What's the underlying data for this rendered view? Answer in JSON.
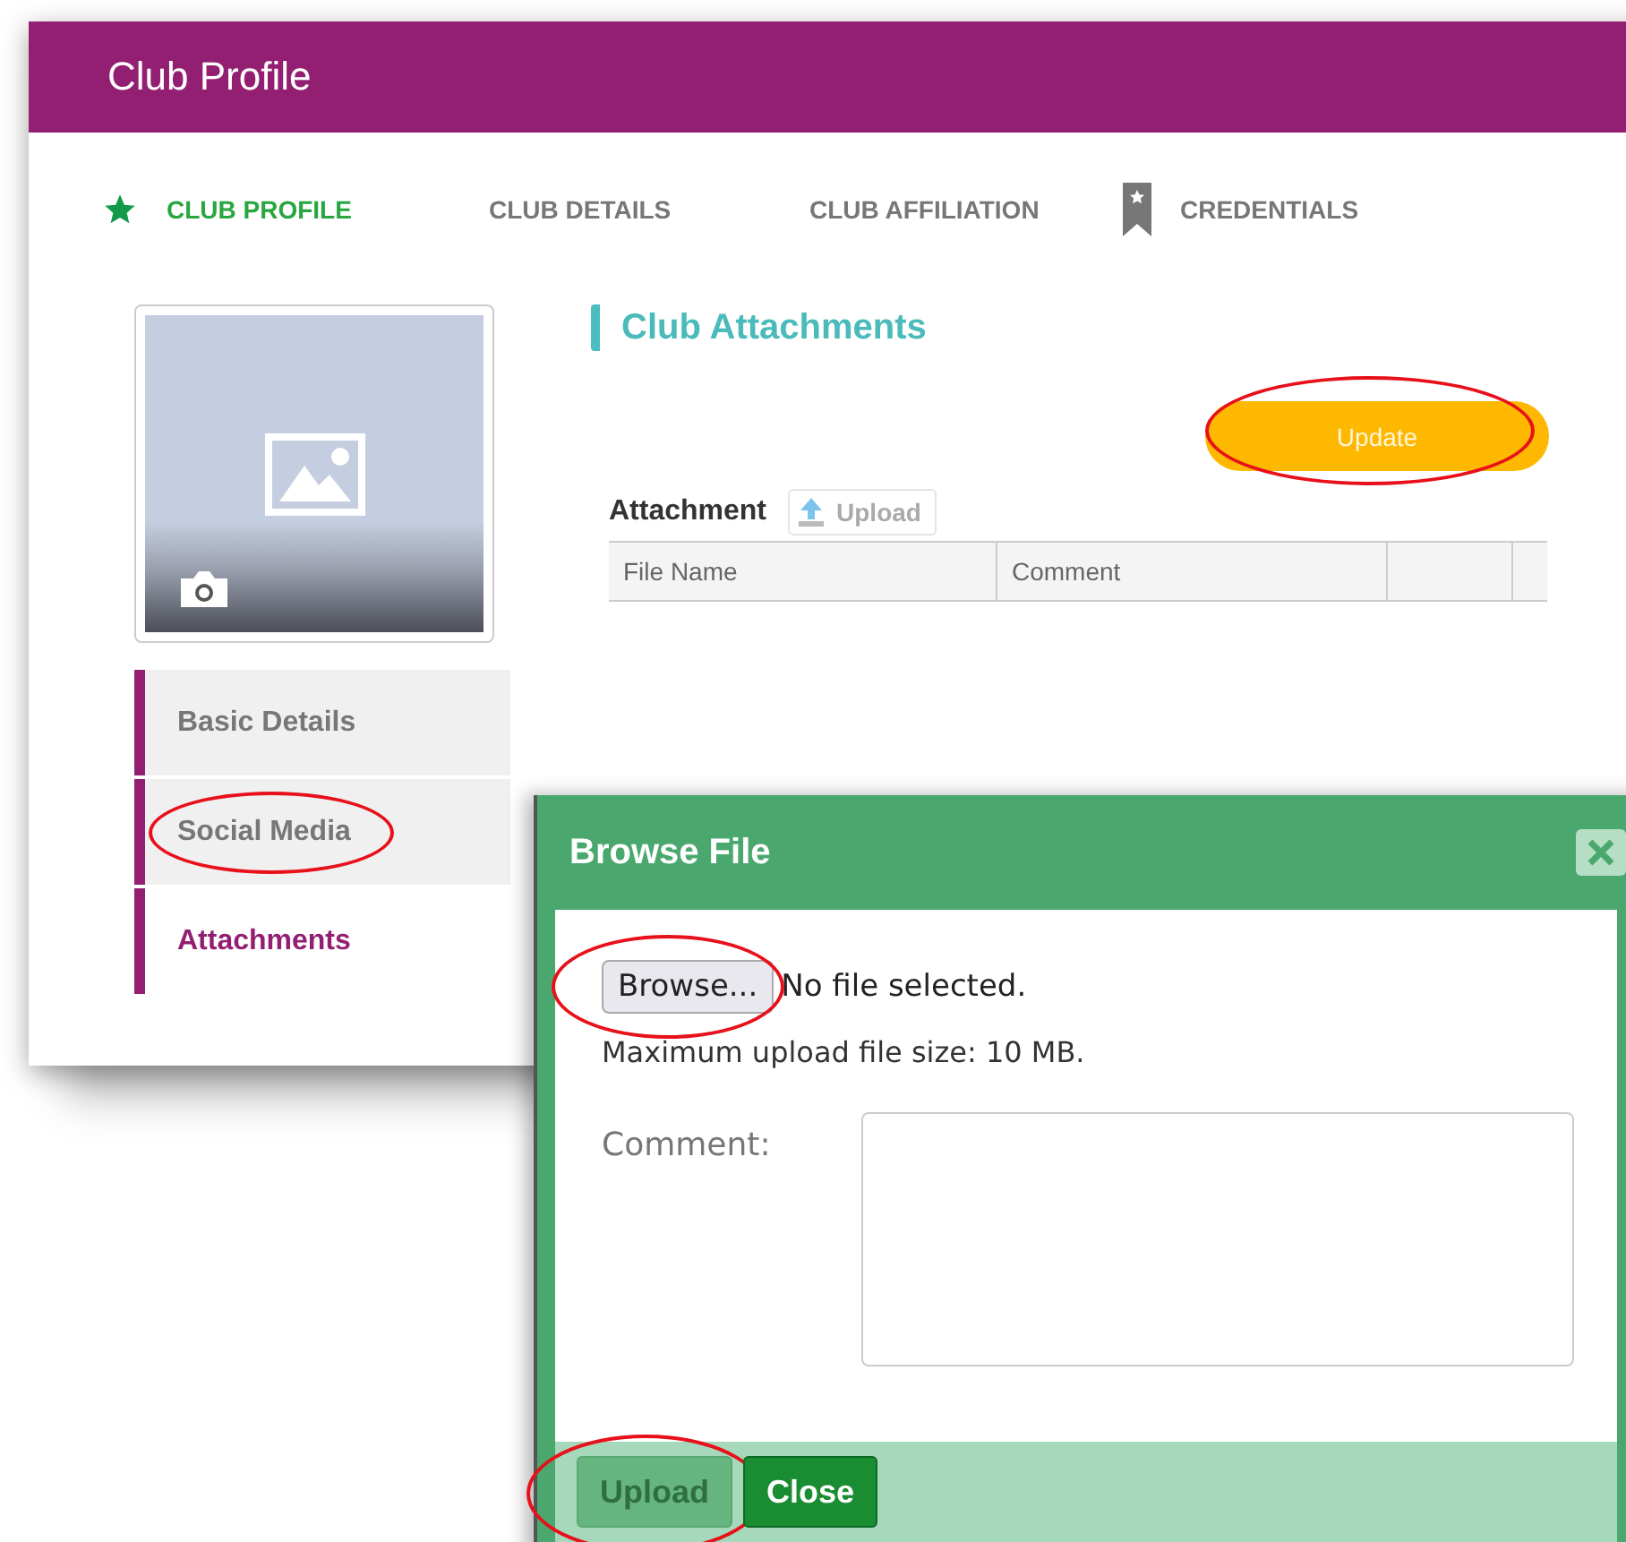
{
  "window": {
    "title": "Club Profile"
  },
  "tabs": [
    {
      "label": "CLUB PROFILE",
      "kind": "starred",
      "selected": true
    },
    {
      "label": "CLUB DETAILS",
      "kind": "plain",
      "selected": false
    },
    {
      "label": "CLUB AFFILIATION",
      "kind": "plain",
      "selected": false
    },
    {
      "label": "CREDENTIALS",
      "kind": "bookmarked",
      "selected": false
    }
  ],
  "sidebar": {
    "items": [
      {
        "label": "Basic Details",
        "selected": false,
        "circled": false
      },
      {
        "label": "Social Media",
        "selected": false,
        "circled": true
      },
      {
        "label": "Attachments",
        "selected": true,
        "circled": false
      }
    ]
  },
  "content": {
    "heading": "Club Attachments",
    "update_button": {
      "label": "Update",
      "circled": true
    },
    "attachment_label": "Attachment",
    "upload_button": "Upload",
    "table": {
      "columns": [
        "File Name",
        "Comment"
      ]
    }
  },
  "dialog": {
    "title": "Browse File",
    "browse_button": {
      "label": "Browse...",
      "circled": true
    },
    "file_status": "No file selected.",
    "hint": "Maximum upload file size: 10 MB.",
    "comment_label": "Comment:",
    "buttons": [
      {
        "label": "Upload",
        "disabled": true,
        "circled": true
      },
      {
        "label": "Close",
        "disabled": false,
        "circled": false
      }
    ]
  }
}
